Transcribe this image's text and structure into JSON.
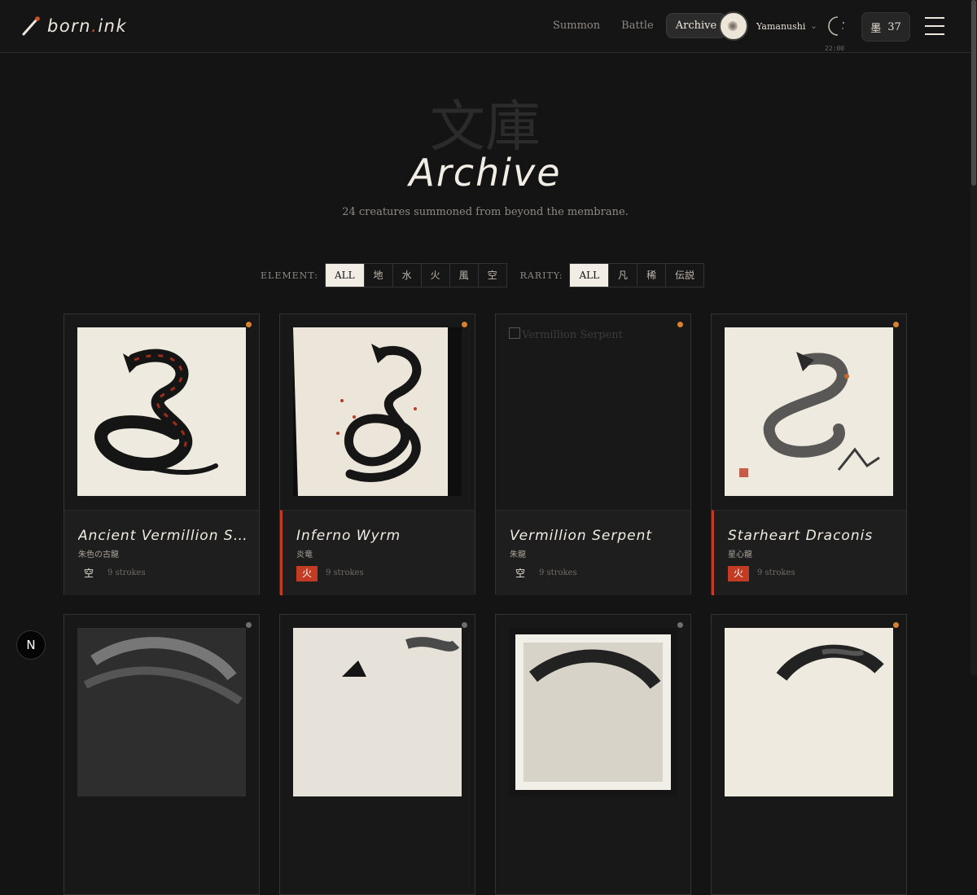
{
  "logo": {
    "part1": "born",
    "dot": ".",
    "part2": "ink"
  },
  "nav": [
    {
      "label": "Summon",
      "active": false
    },
    {
      "label": "Battle",
      "active": false
    },
    {
      "label": "Archive",
      "active": true
    }
  ],
  "user": {
    "name": "Yamanushi"
  },
  "clock": {
    "time": "22:00"
  },
  "ink_balance": {
    "kanji": "墨",
    "value": "37"
  },
  "header": {
    "kanji": "文庫",
    "title": "Archive",
    "subtitle": "24 creatures summoned from beyond the membrane."
  },
  "filters": {
    "element": {
      "label": "ELEMENT:",
      "options": [
        "ALL",
        "地",
        "水",
        "火",
        "風",
        "空"
      ],
      "selected": "ALL"
    },
    "rarity": {
      "label": "RARITY:",
      "options": [
        "ALL",
        "凡",
        "稀",
        "伝説"
      ],
      "selected": "ALL"
    }
  },
  "cards": [
    {
      "name": "Ancient Vermillion Serpent",
      "kanji": "朱色の古龍",
      "element": "空",
      "strokes": "9 strokes",
      "dot_color": "#d9822b",
      "image": "dragon-red-coil"
    },
    {
      "name": "Inferno Wyrm",
      "kanji": "炎竜",
      "element": "火",
      "strokes": "9 strokes",
      "dot_color": "#d9822b",
      "image": "dragon-ink-paper"
    },
    {
      "name": "Vermillion Serpent",
      "kanji": "朱龍",
      "element": "空",
      "strokes": "9 strokes",
      "dot_color": "#d9822b",
      "image": "broken",
      "alt": "Vermillion Serpent"
    },
    {
      "name": "Starheart Draconis",
      "kanji": "星心龍",
      "element": "火",
      "strokes": "9 strokes",
      "dot_color": "#d9822b",
      "image": "dragon-grey-cloud"
    }
  ],
  "cards_row2": [
    {
      "dot_color": "#6e6e6e"
    },
    {
      "dot_color": "#6e6e6e"
    },
    {
      "dot_color": "#6e6e6e"
    },
    {
      "dot_color": "#d9822b"
    }
  ],
  "colors": {
    "accent": "#c23b22",
    "dot": "#d9822b",
    "background": "#141414"
  },
  "dev_badge": "N"
}
